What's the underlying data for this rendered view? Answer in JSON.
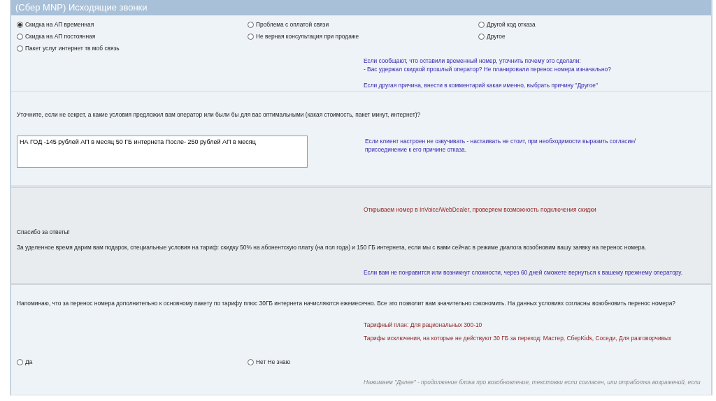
{
  "window": {
    "title": "(Сбер MNP) Исходящие звонки"
  },
  "reasons": {
    "options": [
      {
        "label": "Скидка на АП временная",
        "selected": true
      },
      {
        "label": "Проблема с оплатой связи",
        "selected": false
      },
      {
        "label": "Другой код отказа",
        "selected": false
      },
      {
        "label": "Скидка на АП постоянная",
        "selected": false
      },
      {
        "label": "Не верная консультация при продаже",
        "selected": false
      },
      {
        "label": "Другое",
        "selected": false
      },
      {
        "label": "Пакет услуг  интернет  тв  моб связь",
        "selected": false
      }
    ],
    "hints": [
      {
        "kind": "info",
        "lines": [
          "Если сообщают, что оставили временный номер, уточнить почему это сделали:",
          "- Вас удержал скидкой прошлый оператор? Не планировали перенос номера изначально?"
        ]
      },
      {
        "kind": "info",
        "lines": [
          "Если другая причина, внести в комментарий какая именно, выбрать причину \"Другое\""
        ]
      }
    ]
  },
  "conditions": {
    "question": "Уточните, если не секрет, а какие условия предложил вам оператор или были бы для вас оптимальными (какая стоимость, пакет минут, интернет)?",
    "answer": {
      "value": "НА ГОД -145 рублей АП в месяц 50 ГБ интернета После- 250 рублей АП в месяц"
    },
    "hint": {
      "kind": "info",
      "lines": [
        "Если клиент настроен не озвучивать - настаивать не стоит, при необходимости выразить согласие/",
        "присоединение к его причине отказа."
      ]
    }
  },
  "offer": {
    "instruction": {
      "kind": "alert",
      "lines": [
        "Открываем номер в InVoice/WebDealer, проверяем возможность подключения скидки"
      ]
    },
    "thanks": "Спасибо за ответы!",
    "text": "За уделенное время дарим вам подарок, специальные условия на тариф: скидку 50% на абонентскую плату (на пол года) и 150 ГБ интернета, если мы с вами сейчас в режиме диалога возобновим вашу заявку на перенос номера.",
    "hint": {
      "kind": "info",
      "lines": [
        "Если вам не понравится или возникнут сложности, через 60 дней сможете вернуться к вашему прежнему оператору."
      ]
    }
  },
  "reminder": {
    "text": "Напоминаю, что за перенос номера дополнительно к основному пакету по тарифу плюс 30ГБ интернета начисляются ежемесячно. Все это позволит вам значительно сэкономить. На данных условиях согласны возобновить перенос номера?",
    "notes": [
      {
        "kind": "alert",
        "lines": [
          "Тарифный план: Для рациональных 300-10"
        ]
      },
      {
        "kind": "alert",
        "lines": [
          "Тарифы исключения, на которые не действуют 30 ГБ за переход: Мастер, СберKids, Соседи, Для разговорчивых"
        ]
      }
    ],
    "options": [
      {
        "label": "Да",
        "selected": false
      },
      {
        "label": "Нет  Не знаю",
        "selected": false
      }
    ],
    "footer_note": {
      "kind": "note",
      "lines": [
        "Нажимаем \"Далее\" - продолжение блока про возобновление, текстовки если согласен, или отработка возражений, если"
      ]
    }
  }
}
